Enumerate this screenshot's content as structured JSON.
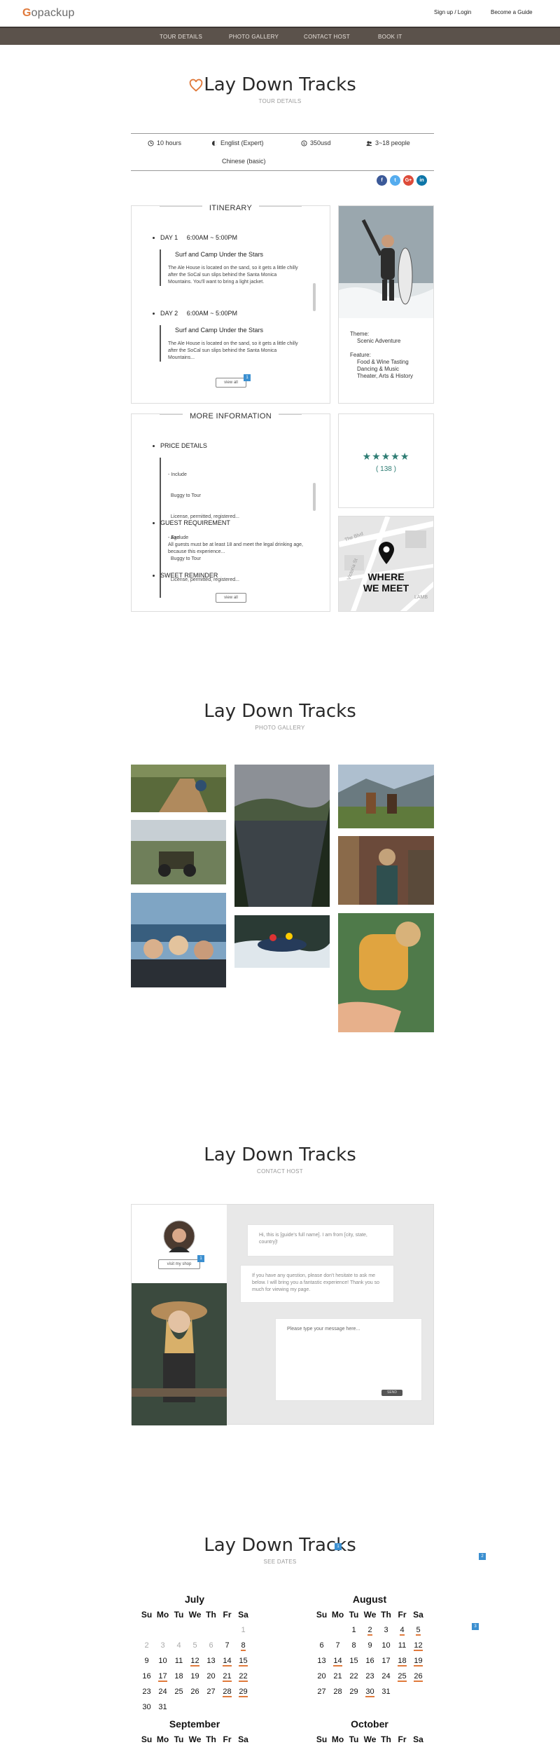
{
  "header": {
    "logo": {
      "g": "G",
      "rest": "opackup"
    },
    "links": [
      "Sign up / Login",
      "Become a Guide"
    ]
  },
  "nav": [
    "TOUR DETAILS",
    "PHOTO GALLERY",
    "CONTACT HOST",
    "BOOK IT"
  ],
  "accent": "#e07a3c",
  "tour": {
    "title": "Lay Down Tracks",
    "subtitle": "TOUR DETAILS",
    "stats": {
      "duration": "10 hours",
      "language1": "Englist (Expert)",
      "language2": "Chinese (basic)",
      "price": "350usd",
      "group": "3~18 people"
    },
    "social": [
      "f",
      "t",
      "G+",
      "in"
    ]
  },
  "itinerary": {
    "title": "ITINERARY",
    "days": [
      {
        "day": "DAY 1",
        "time": "6:00AM ~ 5:00PM",
        "heading": "Surf and Camp Under the Stars",
        "text": "The Ale House is located on the sand, so it gets a little chilly after the SoCal sun slips behind the Santa Monica Mountains. You'll want to bring a light jacket."
      },
      {
        "day": "DAY 2",
        "time": "6:00AM ~ 5:00PM",
        "heading": "Surf and Camp Under the Stars",
        "text": "The Ale House is located on the sand, so it gets a little chilly after the SoCal sun slips behind the Santa Monica Mountains..."
      }
    ],
    "view_all": "view all",
    "badge": "1"
  },
  "theme": {
    "theme_label": "Theme:",
    "theme_value": "Scenic Adventure",
    "feature_label": "Feature:",
    "features": [
      "Food & Wine Tasting",
      "Dancing & Music",
      "Theater, Arts & History"
    ]
  },
  "more_info": {
    "title": "MORE INFORMATION",
    "price_details": "PRICE DETAILS",
    "price_lines": [
      "- Include",
      "  Buggy to Tour",
      "  License, permitted, registered...",
      "- Exclude",
      "  Buggy to Tour",
      "  License, permitted, registered..."
    ],
    "guest_req": "GUEST REQUIREMENT",
    "guest_lines": [
      "- Age",
      "All guests must be at least 18 and meet the legal drinking age, because this experience..."
    ],
    "sweet": "SWEET REMINDER",
    "view_all": "view all"
  },
  "rating": {
    "stars": "★★★★★",
    "count": "( 138 )",
    "value": 5
  },
  "map": {
    "line1": "WHERE",
    "line2": "WE MEET",
    "street1": "The Blvd",
    "street2": "Victoria St",
    "street3": "LAMB"
  },
  "gallery": {
    "title": "Lay Down Tracks",
    "subtitle": "PHOTO GALLERY"
  },
  "contact": {
    "title": "Lay Down Tracks",
    "subtitle": "CONTACT HOST",
    "visit_shop": "visit my shop",
    "badge": "1",
    "msg1": "Hi, this is [guide's full name]. I am from [city, state, country]!",
    "msg2": "If you have any question, please don't hesitate to ask me below. I will bring you a fantastic experience! Thank you so much for viewing my page.",
    "placeholder": "Please type your message here...",
    "send": "SEND"
  },
  "dates": {
    "title": "Lay Down Tracks",
    "subtitle": "SEE DATES",
    "weekdays": [
      "Su",
      "Mo",
      "Tu",
      "We",
      "Th",
      "Fr",
      "Sa"
    ],
    "july": {
      "name": "July",
      "offset": 6,
      "days": 31,
      "muted_before": 7,
      "underline": [
        8,
        12,
        14,
        15,
        17,
        21,
        22,
        28,
        29
      ]
    },
    "august": {
      "name": "August",
      "offset": 2,
      "days": 31,
      "muted_before": 0,
      "underline": [
        2,
        4,
        5,
        12,
        14,
        18,
        19,
        25,
        26,
        30
      ]
    },
    "next_left": "September",
    "next_right": "October",
    "badges": [
      "1",
      "2",
      "3"
    ]
  }
}
